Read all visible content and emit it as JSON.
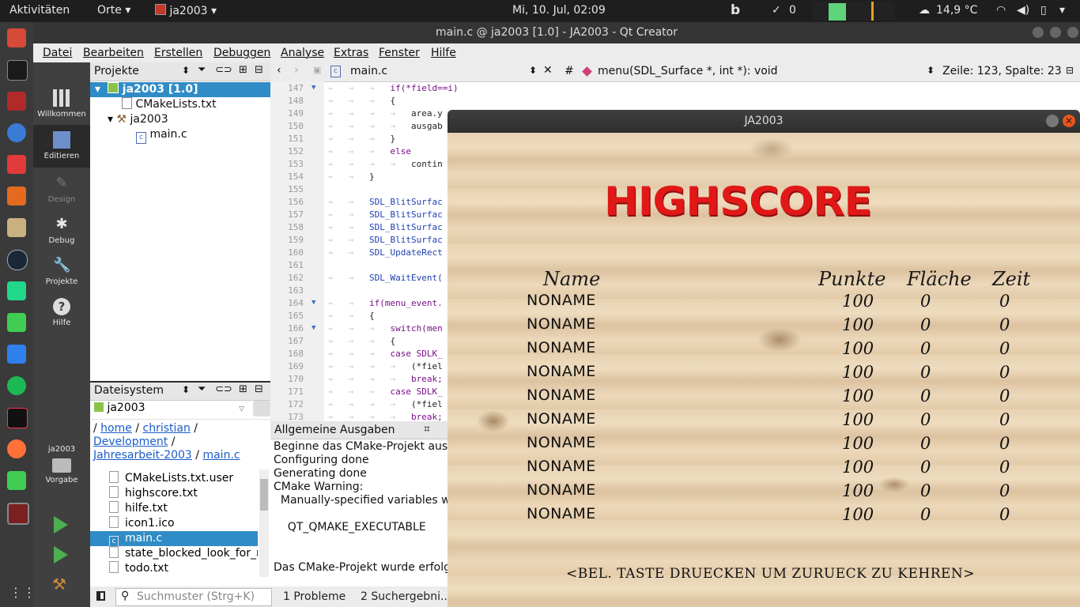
{
  "top_panel": {
    "activities": "Aktivitäten",
    "places": "Orte",
    "app_name": "ja2003",
    "clock": "Mi, 10. Jul, 02:09",
    "notification_count": "0",
    "temperature": "14,9 °C"
  },
  "qt": {
    "window_title": "main.c @ ja2003 [1.0] - JA2003 - Qt Creator",
    "menu": [
      "Datei",
      "Bearbeiten",
      "Erstellen",
      "Debuggen",
      "Analyse",
      "Extras",
      "Fenster",
      "Hilfe"
    ],
    "modes": [
      "Willkommen",
      "Editieren",
      "Design",
      "Debug",
      "Projekte",
      "Hilfe"
    ],
    "kit_label": "ja2003",
    "kit_mode": "Vorgabe",
    "projects_panel": {
      "title": "Projekte",
      "tree": [
        {
          "label": "ja2003 [1.0]",
          "level": 0
        },
        {
          "label": "CMakeLists.txt",
          "level": 1
        },
        {
          "label": "ja2003",
          "level": 1
        },
        {
          "label": "main.c",
          "level": 2
        }
      ]
    },
    "fs_panel": {
      "title": "Dateisystem",
      "root": "ja2003",
      "path_links": [
        "home",
        "christian",
        "Development",
        "Jahresarbeit-2003",
        "main.c"
      ],
      "files": [
        "CMakeLists.txt.user",
        "highscore.txt",
        "hilfe.txt",
        "icon1.ico",
        "main.c",
        "state_blocked_look_for_r",
        "todo.txt"
      ]
    },
    "editor": {
      "file_tab": "main.c",
      "function": "menu(SDL_Surface *, int *): void",
      "cursor": "Zeile: 123, Spalte: 23",
      "lines": [
        {
          "n": "147",
          "code": "if(*field==i)",
          "indent": 3
        },
        {
          "n": "148",
          "code": "{",
          "indent": 3
        },
        {
          "n": "149",
          "code": "area.y",
          "indent": 4
        },
        {
          "n": "150",
          "code": "ausgab",
          "indent": 4
        },
        {
          "n": "151",
          "code": "}",
          "indent": 3
        },
        {
          "n": "152",
          "code": "else",
          "indent": 3
        },
        {
          "n": "153",
          "code": "contin",
          "indent": 4
        },
        {
          "n": "154",
          "code": "}",
          "indent": 2
        },
        {
          "n": "155",
          "code": "",
          "indent": 0
        },
        {
          "n": "156",
          "code": "SDL_BlitSurfac",
          "indent": 2
        },
        {
          "n": "157",
          "code": "SDL_BlitSurfac",
          "indent": 2
        },
        {
          "n": "158",
          "code": "SDL_BlitSurfac",
          "indent": 2
        },
        {
          "n": "159",
          "code": "SDL_BlitSurfac",
          "indent": 2
        },
        {
          "n": "160",
          "code": "SDL_UpdateRect",
          "indent": 2
        },
        {
          "n": "161",
          "code": "",
          "indent": 0
        },
        {
          "n": "162",
          "code": "SDL_WaitEvent(",
          "indent": 2
        },
        {
          "n": "163",
          "code": "",
          "indent": 0
        },
        {
          "n": "164",
          "code": "if(menu_event.",
          "indent": 2
        },
        {
          "n": "165",
          "code": "{",
          "indent": 2
        },
        {
          "n": "166",
          "code": "switch(men",
          "indent": 3
        },
        {
          "n": "167",
          "code": "{",
          "indent": 3
        },
        {
          "n": "168",
          "code": "case SDLK_",
          "indent": 3
        },
        {
          "n": "169",
          "code": "(*fiel",
          "indent": 4
        },
        {
          "n": "170",
          "code": "break;",
          "indent": 4
        },
        {
          "n": "171",
          "code": "case SDLK_",
          "indent": 3
        },
        {
          "n": "172",
          "code": "(*fiel",
          "indent": 4
        },
        {
          "n": "173",
          "code": "break;",
          "indent": 4
        }
      ]
    },
    "output": {
      "title": "Allgemeine Ausgaben",
      "lines": [
        "Beginne das CMake-Projekt ausz",
        "Configuring done",
        "Generating done",
        "CMake Warning:",
        "  Manually-specified variables we",
        "",
        "    QT_QMAKE_EXECUTABLE",
        "",
        "",
        "Das CMake-Projekt wurde erfolg"
      ]
    },
    "bottom": {
      "search_placeholder": "Suchmuster (Strg+K)",
      "problems": "1  Probleme",
      "search_results": "2  Suchergebni..."
    }
  },
  "game": {
    "window_title": "JA2003",
    "heading": "HIGHSCORE",
    "columns": [
      "Name",
      "Punkte",
      "Fläche",
      "Zeit"
    ],
    "rows": [
      {
        "name": "NONAME",
        "points": "100",
        "area": "0",
        "time": "0"
      },
      {
        "name": "NONAME",
        "points": "100",
        "area": "0",
        "time": "0"
      },
      {
        "name": "NONAME",
        "points": "100",
        "area": "0",
        "time": "0"
      },
      {
        "name": "NONAME",
        "points": "100",
        "area": "0",
        "time": "0"
      },
      {
        "name": "NONAME",
        "points": "100",
        "area": "0",
        "time": "0"
      },
      {
        "name": "NONAME",
        "points": "100",
        "area": "0",
        "time": "0"
      },
      {
        "name": "NONAME",
        "points": "100",
        "area": "0",
        "time": "0"
      },
      {
        "name": "NONAME",
        "points": "100",
        "area": "0",
        "time": "0"
      },
      {
        "name": "NONAME",
        "points": "100",
        "area": "0",
        "time": "0"
      },
      {
        "name": "NONAME",
        "points": "100",
        "area": "0",
        "time": "0"
      }
    ],
    "footer": "<BEL. TASTE DRUECKEN UM ZURUECK ZU KEHREN>",
    "heading_color": "#e01818"
  }
}
